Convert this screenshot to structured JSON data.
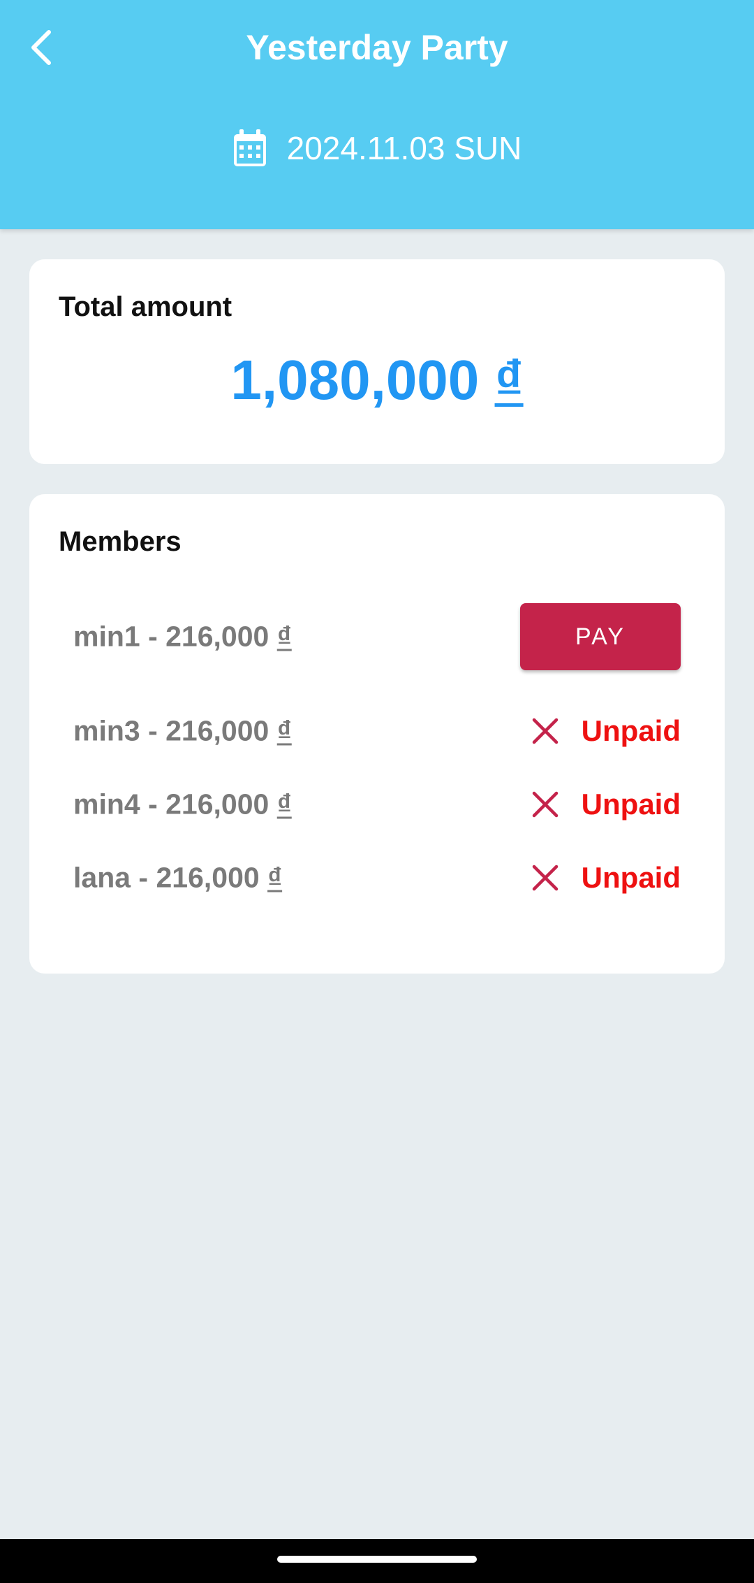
{
  "header": {
    "title": "Yesterday Party",
    "date": "2024.11.03 SUN",
    "back_icon": "chevron-left-icon",
    "calendar_icon": "calendar-icon",
    "background_color": "#57ccf2"
  },
  "total": {
    "heading": "Total amount",
    "amount": "1,080,000",
    "currency": "₫",
    "color": "#2196f3"
  },
  "members": {
    "heading": "Members",
    "rows": [
      {
        "name_amount": "min1 - 216,000 ",
        "currency": "₫",
        "action": "PAY"
      },
      {
        "name_amount": "min3 - 216,000 ",
        "currency": "₫",
        "status": "Unpaid",
        "status_icon": "close-icon"
      },
      {
        "name_amount": "min4 - 216,000 ",
        "currency": "₫",
        "status": "Unpaid",
        "status_icon": "close-icon"
      },
      {
        "name_amount": "lana - 216,000 ",
        "currency": "₫",
        "status": "Unpaid",
        "status_icon": "close-icon"
      }
    ],
    "pay_color": "#c4234a",
    "unpaid_color": "#ee1111"
  }
}
